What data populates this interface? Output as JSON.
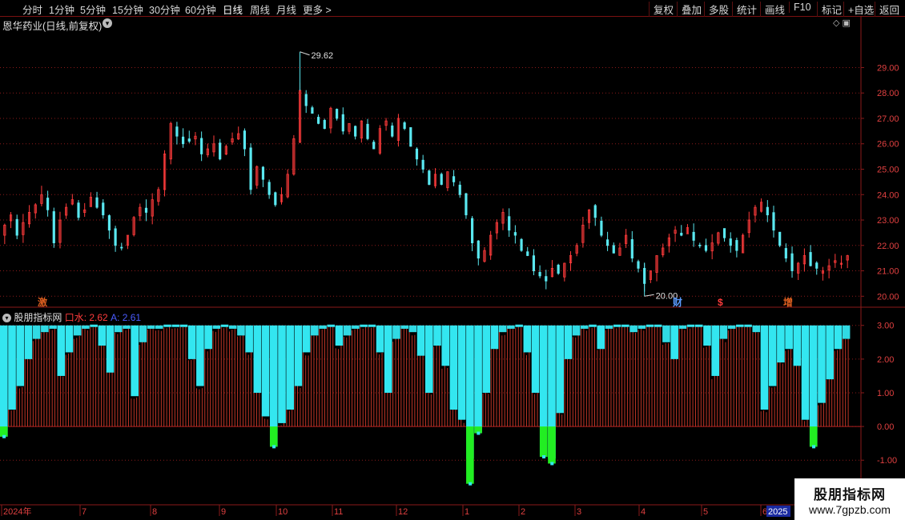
{
  "toolbar": {
    "left": [
      "分时",
      "1分钟",
      "5分钟",
      "15分钟",
      "30分钟",
      "60分钟",
      "日线",
      "周线",
      "月线",
      "更多 >"
    ],
    "right": [
      "复权",
      "叠加",
      "多股",
      "统计",
      "画线",
      "F10",
      "标记",
      "+自选",
      "返回"
    ]
  },
  "main_title": "恩华药业(日线,前复权)",
  "indicator": {
    "name": "股朋指标网",
    "s1_label": "口水: 2.62",
    "s2_label": "A: 2.61"
  },
  "watermark": {
    "line1": "股朋指标网",
    "line2": "www.7gpzb.com"
  },
  "markers": {
    "ji": "激",
    "cai": "财",
    "s": "$",
    "zeng": "增"
  },
  "colors": {
    "up": "#ff3b3b",
    "down": "#5ae8f0",
    "grid": "#8b1a1a",
    "cyan": "#33e6f0",
    "green": "#22ee22",
    "red_bar": "#d23a2a"
  },
  "chart_data": [
    {
      "type": "candlestick",
      "title": "恩华药业(日线,前复权)",
      "y_ticks": [
        "29.00",
        "28.00",
        "27.00",
        "26.00",
        "25.00",
        "24.00",
        "23.00",
        "22.00",
        "21.00",
        "20.00"
      ],
      "ylim": [
        19.6,
        30.4
      ],
      "annotations": {
        "high": "29.62",
        "low": "20.00"
      },
      "closes": [
        22.8,
        23.2,
        22.4,
        22.9,
        23.3,
        23.6,
        24.0,
        23.4,
        22.1,
        23.0,
        23.5,
        23.8,
        23.1,
        23.4,
        23.9,
        23.5,
        23.2,
        22.6,
        22.0,
        21.9,
        22.4,
        23.1,
        23.5,
        23.3,
        23.8,
        24.2,
        25.6,
        26.8,
        26.3,
        26.0,
        26.1,
        26.3,
        25.6,
        25.8,
        26.0,
        25.4,
        25.9,
        26.2,
        26.4,
        25.8,
        24.2,
        25.1,
        24.6,
        24.0,
        23.6,
        24.0,
        24.8,
        26.2,
        28.1,
        27.5,
        27.2,
        26.8,
        26.6,
        27.4,
        27.0,
        26.5,
        26.8,
        26.3,
        26.9,
        26.2,
        25.8,
        26.6,
        26.9,
        26.3,
        27.0,
        26.6,
        25.9,
        25.4,
        25.0,
        24.4,
        24.8,
        24.4,
        24.9,
        24.5,
        24.0,
        23.2,
        22.1,
        21.5,
        21.8,
        22.4,
        22.9,
        23.3,
        22.6,
        22.4,
        21.8,
        21.6,
        21.0,
        20.8,
        20.6,
        21.1,
        20.9,
        21.3,
        21.6,
        22.0,
        22.8,
        23.4,
        23.1,
        22.4,
        22.0,
        21.7,
        21.9,
        22.4,
        21.5,
        21.1,
        20.5,
        21.0,
        21.6,
        21.9,
        22.3,
        22.6,
        22.4,
        22.7,
        22.2,
        22.0,
        21.8,
        22.1,
        22.5,
        22.3,
        22.0,
        21.8,
        22.4,
        23.0,
        23.5,
        23.7,
        23.2,
        22.6,
        22.0,
        21.5,
        21.0,
        21.3,
        21.6,
        21.2,
        21.1,
        21.0,
        21.2,
        21.4,
        21.3,
        21.6
      ],
      "x_labels": [
        "2024年",
        "7",
        "8",
        "9",
        "10",
        "11",
        "12",
        "1",
        "2",
        "3",
        "4",
        "5",
        "6"
      ]
    },
    {
      "type": "bar",
      "series": [
        {
          "name": "口水",
          "value": 2.62
        },
        {
          "name": "A",
          "value": 2.61
        }
      ],
      "y_ticks": [
        "3.00",
        "2.00",
        "1.00",
        "0.00",
        "-1.00"
      ],
      "ylim": [
        -2.3,
        3.35
      ],
      "values": [
        -0.3,
        0.5,
        1.2,
        2.0,
        2.6,
        2.8,
        2.9,
        1.5,
        2.2,
        2.7,
        2.9,
        3.0,
        2.4,
        1.6,
        2.8,
        2.9,
        0.9,
        2.5,
        2.9,
        2.9,
        3.0,
        3.0,
        3.0,
        2.0,
        1.2,
        2.3,
        2.9,
        3.0,
        2.9,
        2.7,
        2.2,
        1.0,
        0.3,
        -0.6,
        0.1,
        0.5,
        1.2,
        2.2,
        2.7,
        2.9,
        3.0,
        2.4,
        2.7,
        2.9,
        3.0,
        3.0,
        2.2,
        1.0,
        2.6,
        2.9,
        2.8,
        2.1,
        1.0,
        2.4,
        1.8,
        0.5,
        0.2,
        -1.7,
        -0.2,
        1.0,
        2.3,
        2.8,
        2.9,
        3.0,
        2.2,
        1.0,
        -0.9,
        -1.1,
        0.4,
        2.0,
        2.7,
        2.9,
        3.0,
        2.3,
        2.9,
        3.0,
        3.0,
        2.8,
        2.9,
        3.0,
        3.0,
        2.5,
        2.0,
        2.9,
        3.0,
        3.0,
        2.4,
        1.5,
        2.6,
        2.9,
        3.0,
        3.0,
        2.8,
        0.5,
        1.2,
        1.9,
        2.3,
        1.8,
        0.2,
        -0.6,
        0.7,
        1.4,
        2.3,
        2.6
      ]
    }
  ]
}
